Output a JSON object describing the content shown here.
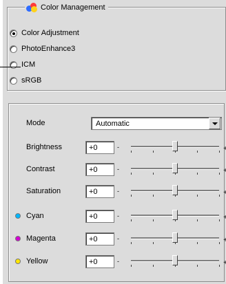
{
  "group": {
    "title": "Color Management",
    "options": [
      {
        "label": "Color Adjustment",
        "selected": true
      },
      {
        "label": "PhotoEnhance3",
        "selected": false
      },
      {
        "label": "ICM",
        "selected": false
      },
      {
        "label": "sRGB",
        "selected": false
      }
    ]
  },
  "mode": {
    "label": "Mode",
    "value": "Automatic"
  },
  "sliders": [
    {
      "label": "Brightness",
      "value": "+0",
      "level": 0.5
    },
    {
      "label": "Contrast",
      "value": "+0",
      "level": 0.5
    },
    {
      "label": "Saturation",
      "value": "+0",
      "level": 0.5
    },
    {
      "label": "Cyan",
      "value": "+0",
      "level": 0.5,
      "color": "#00b7ff"
    },
    {
      "label": "Magenta",
      "value": "+0",
      "level": 0.5,
      "color": "#d400d4"
    },
    {
      "label": "Yellow",
      "value": "+0",
      "level": 0.5,
      "color": "#ffe600"
    }
  ],
  "colors": {
    "panel": "#dcdcdc",
    "border": "#8c8c8c"
  },
  "icons": {
    "group": "color-management-icon",
    "dropdown": "chevron-down-icon"
  }
}
